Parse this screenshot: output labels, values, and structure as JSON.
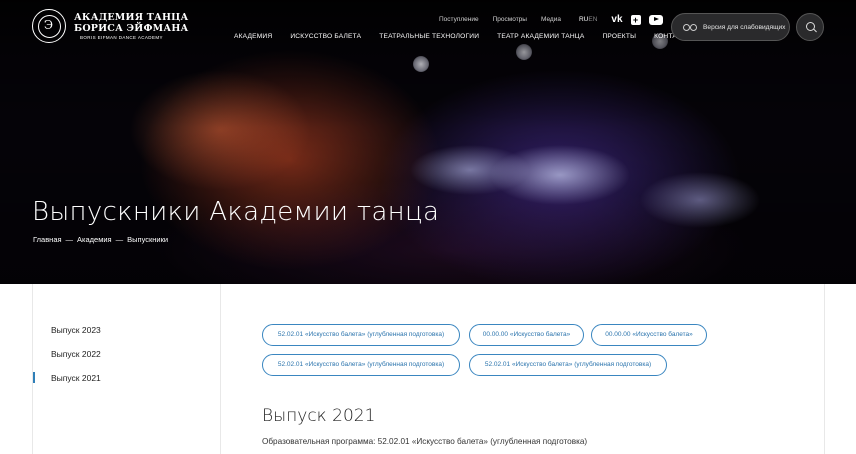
{
  "logo": {
    "line1": "АКАДЕМИЯ ТАНЦА",
    "line2": "БОРИСА ЭЙФМАНА",
    "line3": "BORIS EIFMAN DANCE ACADEMY"
  },
  "top_nav": [
    "Поступление",
    "Просмотры",
    "Медиа"
  ],
  "lang": {
    "active": "RU",
    "inactive": "EN"
  },
  "social": [
    "vk-icon",
    "ok-icon",
    "youtube-icon"
  ],
  "main_nav": [
    "АКАДЕМИЯ",
    "ИСКУССТВО БАЛЕТА",
    "ТЕАТРАЛЬНЫЕ ТЕХНОЛОГИИ",
    "ТЕАТР АКАДЕМИИ ТАНЦА",
    "ПРОЕКТЫ",
    "КОНТАКТЫ"
  ],
  "vision_button": "Версия для слабовидящих",
  "hero": {
    "title": "Выпускники Академии танца",
    "breadcrumb": [
      "Главная",
      "Академия",
      "Выпускники"
    ],
    "separator": "—"
  },
  "sidebar": {
    "items": [
      "Выпуск 2023",
      "Выпуск 2022",
      "Выпуск 2021"
    ],
    "active_index": 2
  },
  "programs": [
    "52.02.01 «Искусство балета» (углубленная подготовка)",
    "00.00.00 «Искусство балета»",
    "00.00.00 «Искусство балета»",
    "52.02.01 «Искусство балета» (углубленная подготовка)",
    "52.02.01 «Искусство балета» (углубленная подготовка)"
  ],
  "section": {
    "title": "Выпуск 2021",
    "program_text": "Образовательная программа: 52.02.01 «Искусство балета» (углубленная подготовка)"
  },
  "colors": {
    "accent": "#2f7fb8",
    "hero_bg": "#050308"
  }
}
